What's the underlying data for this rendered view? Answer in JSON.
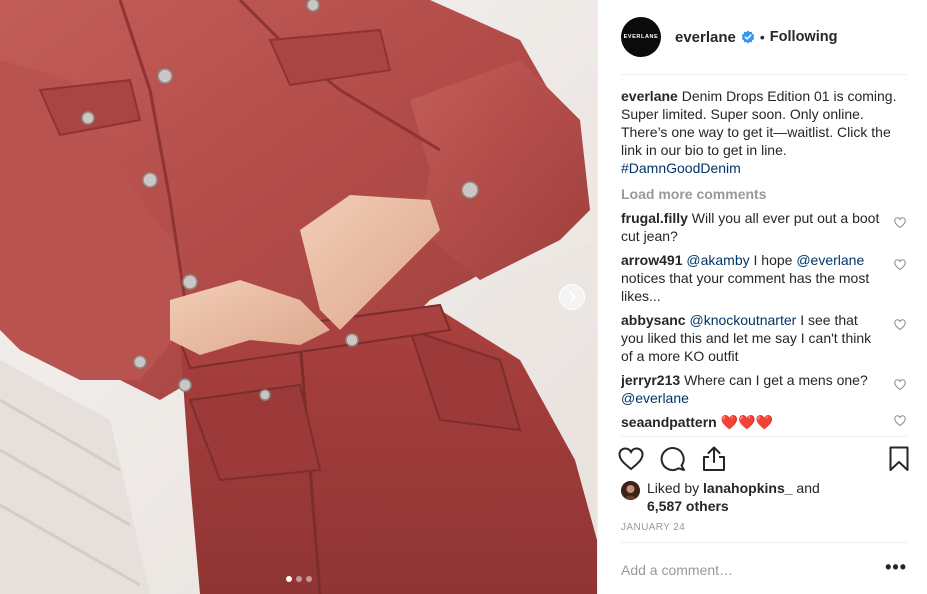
{
  "post": {
    "photo_alt": "Person wearing red denim jacket and red jeans",
    "carousel": {
      "total": 3,
      "active_index": 0
    }
  },
  "header": {
    "avatar_text": "EVERLANE",
    "username": "everlane",
    "separator": "•",
    "follow_status": "Following"
  },
  "caption": {
    "username": "everlane",
    "text": "Denim Drops Edition 01 is coming. Super limited. Super soon. Only online. There’s one way to get it—waitlist. Click the link in our bio to get in line.",
    "hashtag": "#DamnGoodDenim"
  },
  "load_more": "Load more comments",
  "comments": [
    {
      "username": "frugal.filly",
      "mention": "",
      "text": "Will you all ever put out a boot cut jean?"
    },
    {
      "username": "arrow491",
      "mention": "@akamby",
      "text_before_mention2": "I hope",
      "mention2": "@everlane",
      "text": "notices that your comment has the most likes..."
    },
    {
      "username": "abbysanc",
      "mention": "@knockoutnarter",
      "text": "I see that you liked this and let me say I can't think of a more KO outfit"
    },
    {
      "username": "jerryr213",
      "mention": "",
      "text": "Where can I get a mens one?",
      "trailing_mention": "@everlane"
    },
    {
      "username": "seaandpattern",
      "mention": "",
      "text": "❤️❤️❤️"
    }
  ],
  "likes": {
    "prefix": "Liked by",
    "user": "lanahopkins_",
    "conjunction": "and",
    "others": "6,587 others"
  },
  "date": "JANUARY 24",
  "add_comment": {
    "placeholder": "Add a comment…",
    "more": "•••"
  },
  "colors": {
    "verified": "#3897f0",
    "link": "#003569",
    "muted": "#999999",
    "text": "#262626",
    "denim": "#b4504d"
  }
}
